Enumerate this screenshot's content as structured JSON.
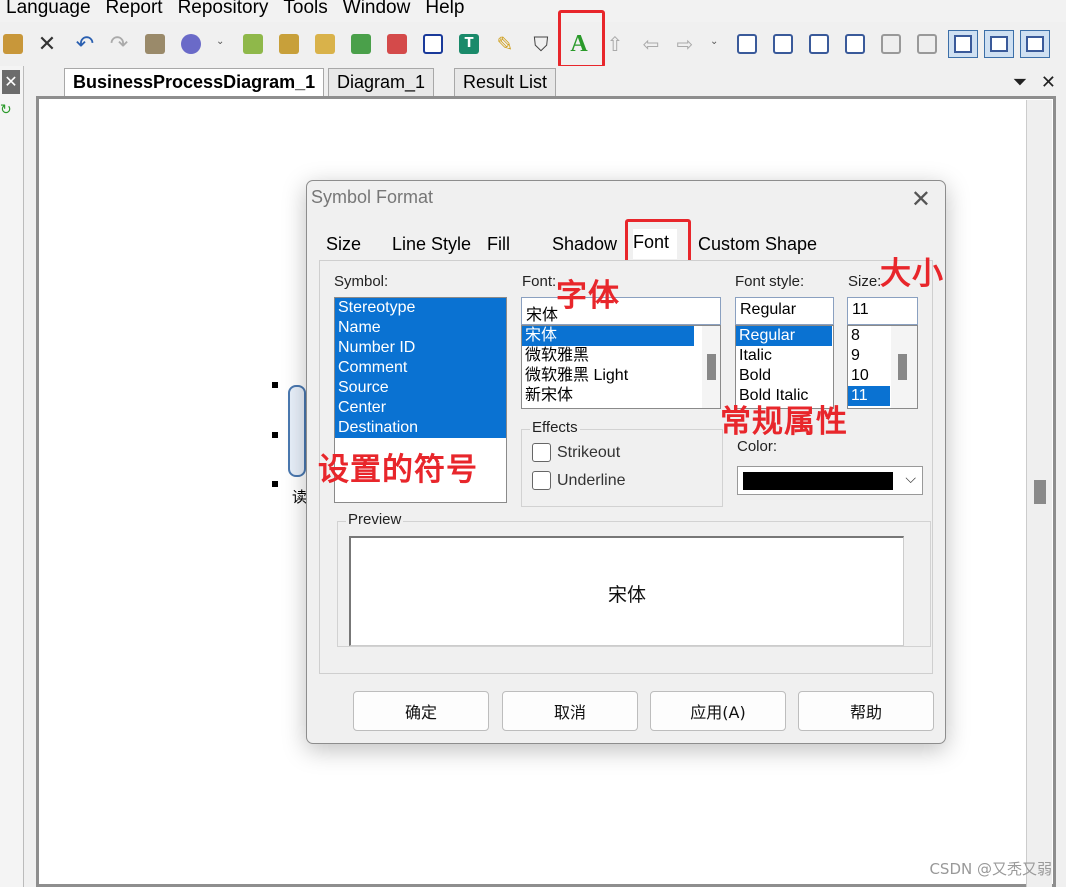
{
  "menu": [
    "Language",
    "Report",
    "Repository",
    "Tools",
    "Window",
    "Help"
  ],
  "toolbar_icons": [
    "paste-icon",
    "delete-icon",
    "undo-icon",
    "redo-icon",
    "properties-icon",
    "settings-icon",
    "new-diagram-icon",
    "open-icon",
    "find-icon",
    "refresh-icon",
    "validate-icon",
    "shape-icon",
    "text-icon",
    "brush-icon",
    "paint-bucket-icon",
    "font-icon",
    "export-icon",
    "back-icon",
    "forward-icon"
  ],
  "colors": {
    "accent": "#0a72d2",
    "annotation": "#e8262b"
  },
  "doc_tabs": [
    {
      "label": "BusinessProcessDiagram_1",
      "active": true
    },
    {
      "label": "Diagram_1",
      "active": false
    },
    {
      "label": "Result List",
      "active": false
    }
  ],
  "canvas": {
    "actor_label": "读"
  },
  "dialog": {
    "title": "Symbol Format",
    "tabs": [
      "Size",
      "Line Style",
      "Fill",
      "Shadow",
      "Font",
      "Custom Shape"
    ],
    "active_tab": "Font",
    "symbol": {
      "label": "Symbol:",
      "items": [
        "Stereotype",
        "Name",
        "Number ID",
        "Comment",
        "Source",
        "Center",
        "Destination"
      ]
    },
    "font": {
      "label": "Font:",
      "value": "宋体",
      "options": [
        "宋体",
        "微软雅黑",
        "微软雅黑 Light",
        "新宋体"
      ]
    },
    "font_style": {
      "label": "Font style:",
      "value": "Regular",
      "options": [
        "Regular",
        "Italic",
        "Bold",
        "Bold Italic"
      ]
    },
    "size": {
      "label": "Size:",
      "value": "11",
      "options": [
        "8",
        "9",
        "10",
        "11"
      ]
    },
    "effects": {
      "label": "Effects",
      "strikeout": "Strikeout",
      "underline": "Underline"
    },
    "color": {
      "label": "Color:",
      "value": "#000000"
    },
    "preview": {
      "label": "Preview",
      "text": "宋体"
    },
    "buttons": {
      "ok": "确定",
      "cancel": "取消",
      "apply": "应用(A)",
      "help": "帮助"
    }
  },
  "annotations": {
    "font": "字体",
    "size": "大小",
    "style": "常规属性",
    "symbol": "设置的符号"
  },
  "watermark": "CSDN @又秃又弱"
}
